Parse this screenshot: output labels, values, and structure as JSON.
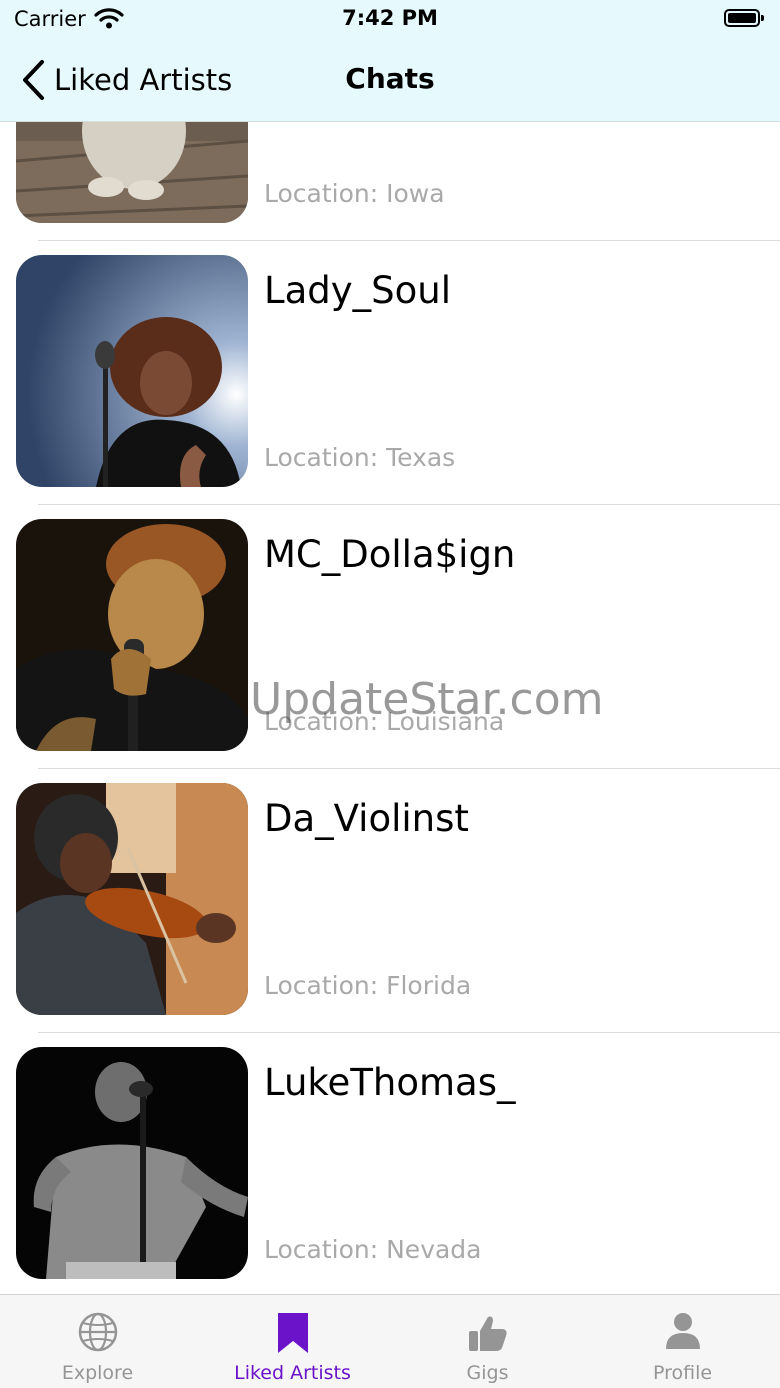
{
  "status_bar": {
    "carrier": "Carrier",
    "time": "7:42 PM"
  },
  "nav": {
    "back_label": "Liked Artists",
    "title": "Chats"
  },
  "artists": [
    {
      "name": "",
      "location": "Location: Iowa"
    },
    {
      "name": "Lady_Soul",
      "location": "Location: Texas"
    },
    {
      "name": "MC_Dolla$ign",
      "location": "Location: Louisiana"
    },
    {
      "name": "Da_Violinst",
      "location": "Location: Florida"
    },
    {
      "name": "LukeThomas_",
      "location": "Location: Nevada"
    }
  ],
  "watermark": "UpdateStar.com",
  "tabs": [
    {
      "label": "Explore",
      "icon": "globe-icon"
    },
    {
      "label": "Liked Artists",
      "icon": "bookmark-icon",
      "active": true
    },
    {
      "label": "Gigs",
      "icon": "thumbs-up-icon"
    },
    {
      "label": "Profile",
      "icon": "person-icon"
    }
  ],
  "colors": {
    "nav_background": "#e6fafe",
    "accent": "#6a13c9",
    "inactive_tab": "#959595",
    "location_text": "#a9a9a9"
  }
}
